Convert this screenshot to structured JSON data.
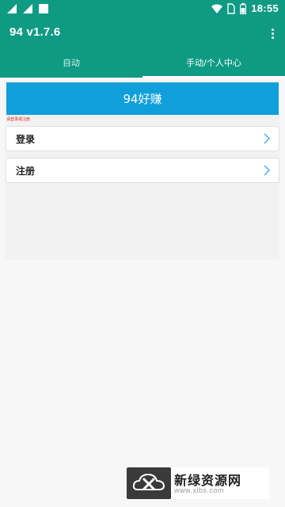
{
  "status_bar": {
    "time": "18:55",
    "icons": [
      "signal-icon",
      "wifi-icon",
      "sim-icon",
      "battery-icon",
      "notification-icon"
    ]
  },
  "app_bar": {
    "title": "94 v1.7.6",
    "menu_icon": "overflow-menu-icon"
  },
  "tabs": [
    {
      "label": "自动",
      "active": false
    },
    {
      "label": "手动/个人中心",
      "active": true
    }
  ],
  "main": {
    "banner_title": "94好赚",
    "notice_text": "请登录或注册",
    "menu_items": [
      {
        "label": "登录",
        "icon": "chevron-right-icon"
      },
      {
        "label": "注册",
        "icon": "chevron-right-icon"
      }
    ]
  },
  "watermark": {
    "text": "新绿资源网",
    "sub": "www.xlbs.com"
  },
  "colors": {
    "primary": "#0f9a84",
    "banner": "#0f9fdb",
    "notice": "#e02b2b",
    "chevron": "#4aa9de"
  }
}
